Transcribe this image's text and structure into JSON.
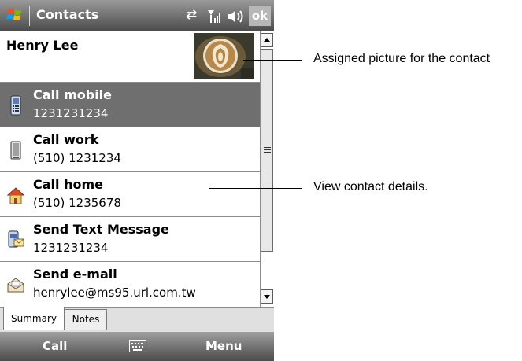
{
  "title_bar": {
    "title": "Contacts",
    "ok_label": "ok",
    "icons": [
      "windows-start-icon",
      "sync-arrows-icon",
      "signal-strength-icon",
      "speaker-volume-icon"
    ]
  },
  "contact": {
    "name": "Henry Lee",
    "photo_icon": "latte-art-photo"
  },
  "actions": [
    {
      "label": "Call mobile",
      "value": "1231231234",
      "icon": "mobile-phone-icon",
      "selected": true
    },
    {
      "label": "Call work",
      "value": "(510) 1231234",
      "icon": "work-phone-icon",
      "selected": false
    },
    {
      "label": "Call home",
      "value": "(510) 1235678",
      "icon": "home-icon",
      "selected": false
    },
    {
      "label": "Send Text Message",
      "value": "1231231234",
      "icon": "text-message-icon",
      "selected": false
    },
    {
      "label": "Send e-mail",
      "value": "henrylee@ms95.url.com.tw",
      "icon": "email-envelope-icon",
      "selected": false
    }
  ],
  "tabs": [
    {
      "label": "Summary",
      "active": true
    },
    {
      "label": "Notes",
      "active": false
    }
  ],
  "softkeys": {
    "left": "Call",
    "right": "Menu",
    "center_icon": "keyboard-icon"
  },
  "callouts": {
    "picture": "Assigned picture for the contact",
    "details": "View contact details."
  },
  "colors": {
    "title_bar": "#6e6e6e",
    "selected_row": "#6f6f6f",
    "row_divider": "#8c8c8c"
  }
}
